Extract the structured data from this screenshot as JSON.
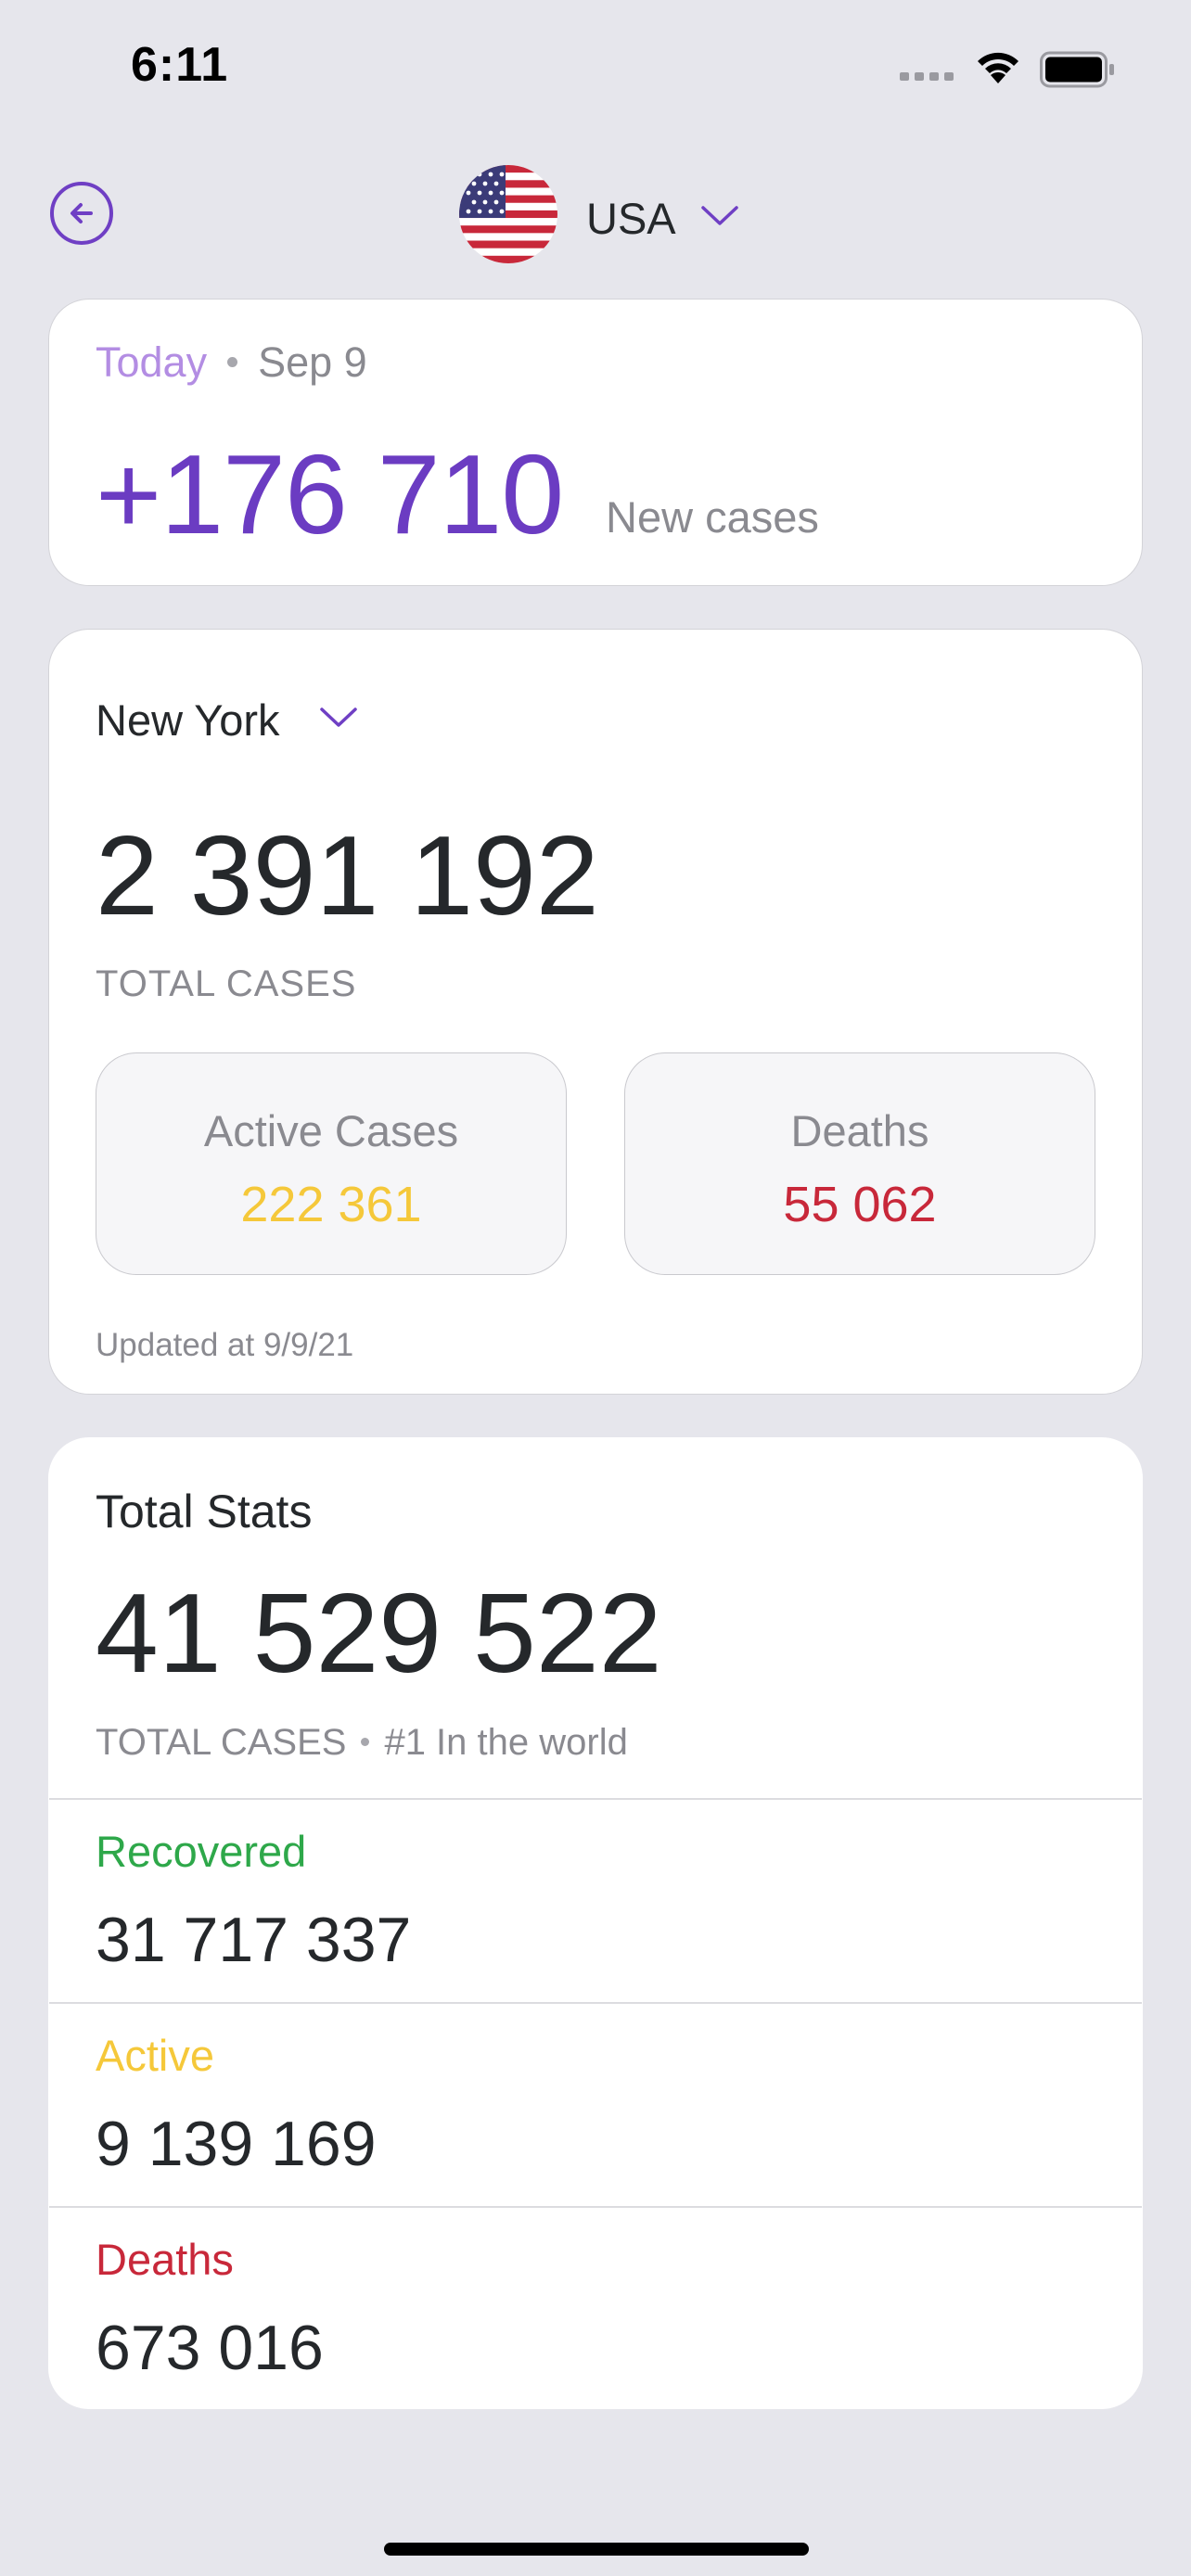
{
  "status_bar": {
    "time": "6:11"
  },
  "header": {
    "country": "USA"
  },
  "today_card": {
    "label": "Today",
    "date": "Sep 9",
    "new_cases": "+176 710",
    "new_cases_label": "New cases"
  },
  "region_card": {
    "region": "New York",
    "total_cases": "2 391 192",
    "total_cases_label": "TOTAL CASES",
    "active_label": "Active Cases",
    "active_value": "222 361",
    "deaths_label": "Deaths",
    "deaths_value": "55 062",
    "updated": "Updated at 9/9/21"
  },
  "total_stats": {
    "title": "Total Stats",
    "total_cases": "41 529 522",
    "total_cases_label": "TOTAL CASES",
    "rank": "#1 In the world",
    "rows": [
      {
        "label": "Recovered",
        "value": "31 717 337",
        "color": "#2EA84A"
      },
      {
        "label": "Active",
        "value": "9 139 169",
        "color": "#F5C83A"
      },
      {
        "label": "Deaths",
        "value": "673 016",
        "color": "#C8283A"
      }
    ]
  },
  "colors": {
    "accent": "#6B3CC2",
    "today": "#B38DE3",
    "active": "#F5C83A",
    "deaths": "#C8283A",
    "recovered": "#2EA84A",
    "background": "#E6E6EC"
  },
  "icons": [
    "back-arrow-icon",
    "usa-flag-icon",
    "chevron-down-icon",
    "wifi-icon",
    "battery-icon",
    "cellular-signal-icon"
  ]
}
